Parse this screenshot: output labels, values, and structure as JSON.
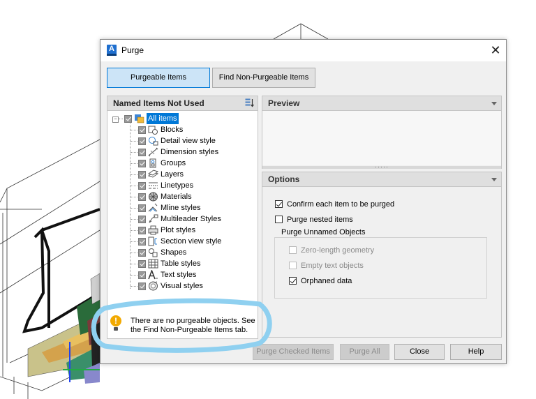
{
  "dialog": {
    "title": "Purge",
    "app_icon_letter": "A",
    "close_glyph": "✕"
  },
  "tabs": [
    {
      "label": "Purgeable Items",
      "active": true
    },
    {
      "label": "Find Non-Purgeable Items",
      "active": false
    }
  ],
  "tree": {
    "header": "Named Items Not Used",
    "root": {
      "label": "All items",
      "checked": true,
      "selected": true,
      "expander": "−"
    },
    "items": [
      {
        "label": "Blocks",
        "checked": true,
        "icon": "blocks-icon"
      },
      {
        "label": "Detail view style",
        "checked": true,
        "icon": "detail-view-style-icon"
      },
      {
        "label": "Dimension styles",
        "checked": true,
        "icon": "dimension-styles-icon"
      },
      {
        "label": "Groups",
        "checked": true,
        "icon": "groups-icon"
      },
      {
        "label": "Layers",
        "checked": true,
        "icon": "layers-icon"
      },
      {
        "label": "Linetypes",
        "checked": true,
        "icon": "linetypes-icon"
      },
      {
        "label": "Materials",
        "checked": true,
        "icon": "materials-icon"
      },
      {
        "label": "Mline styles",
        "checked": true,
        "icon": "mline-styles-icon"
      },
      {
        "label": "Multileader Styles",
        "checked": true,
        "icon": "multileader-styles-icon"
      },
      {
        "label": "Plot styles",
        "checked": true,
        "icon": "plot-styles-icon"
      },
      {
        "label": "Section view style",
        "checked": true,
        "icon": "section-view-style-icon"
      },
      {
        "label": "Shapes",
        "checked": true,
        "icon": "shapes-icon"
      },
      {
        "label": "Table styles",
        "checked": true,
        "icon": "table-styles-icon"
      },
      {
        "label": "Text styles",
        "checked": true,
        "icon": "text-styles-icon"
      },
      {
        "label": "Visual styles",
        "checked": true,
        "icon": "visual-styles-icon"
      }
    ]
  },
  "notice": {
    "text": "There are no purgeable objects. See the Find Non-Purgeable Items tab.",
    "icon": "warning-icon"
  },
  "preview": {
    "header": "Preview"
  },
  "options": {
    "header": "Options",
    "confirm_each": {
      "label": "Confirm each item to be purged",
      "checked": true
    },
    "purge_nested": {
      "label": "Purge nested items",
      "checked": false
    },
    "group_title": "Purge Unnamed Objects",
    "zero_length": {
      "label": "Zero-length geometry",
      "checked": false,
      "enabled": false
    },
    "empty_text": {
      "label": "Empty text objects",
      "checked": false,
      "enabled": false
    },
    "orphaned": {
      "label": "Orphaned data",
      "checked": true,
      "enabled": true
    }
  },
  "buttons": {
    "purge_checked": "Purge Checked Items",
    "purge_all": "Purge All",
    "close": "Close",
    "help": "Help"
  },
  "colors": {
    "accent": "#0078d7",
    "active_tab_bg": "#cce4f7",
    "highlight_circle": "#8fd0f0",
    "warning": "#f2a900"
  }
}
